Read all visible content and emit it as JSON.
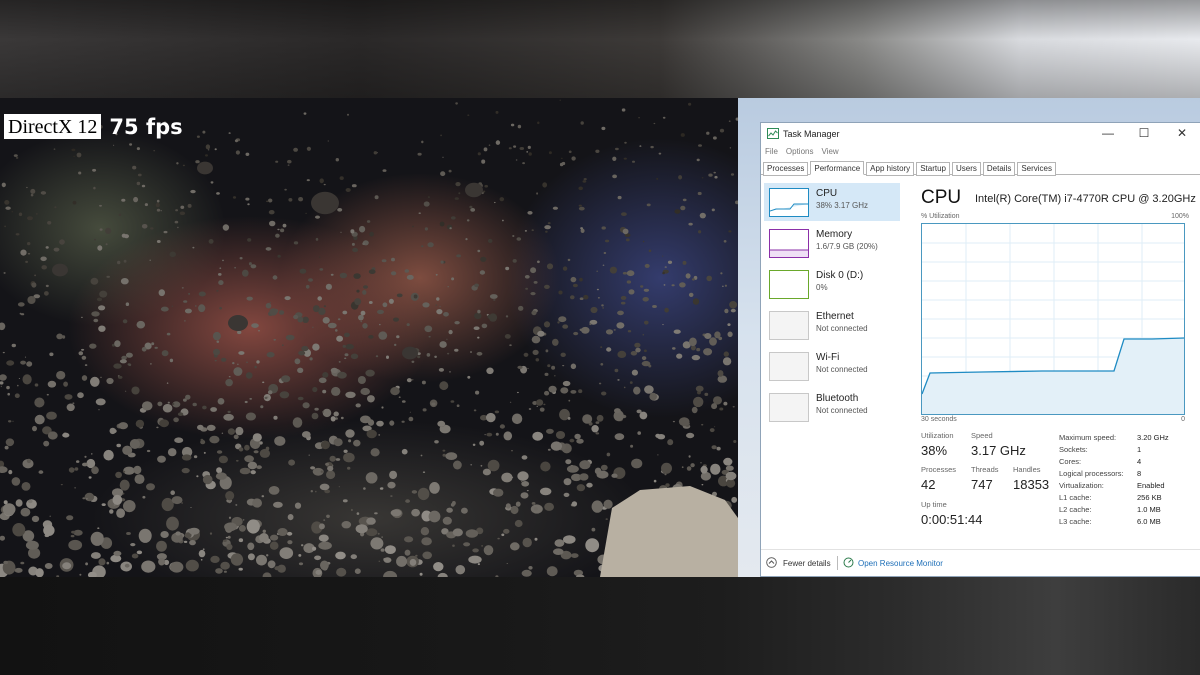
{
  "overlay": {
    "api_label": "DirectX 12",
    "fps_label": "75 fps"
  },
  "task_manager": {
    "title": "Task Manager",
    "window_buttons": {
      "minimize": "—",
      "maximize": "☐",
      "close": "✕"
    },
    "menu": [
      "File",
      "Options",
      "View"
    ],
    "tabs": [
      "Processes",
      "Performance",
      "App history",
      "Startup",
      "Users",
      "Details",
      "Services"
    ],
    "active_tab": "Performance",
    "sidebar": [
      {
        "name": "CPU",
        "detail": "38%  3.17 GHz",
        "color": "#1e8bc3"
      },
      {
        "name": "Memory",
        "detail": "1.6/7.9 GB (20%)",
        "color": "#8b2fa8"
      },
      {
        "name": "Disk 0 (D:)",
        "detail": "0%",
        "color": "#6aa82b"
      },
      {
        "name": "Ethernet",
        "detail": "Not connected",
        "color": "#c8c8c8"
      },
      {
        "name": "Wi-Fi",
        "detail": "Not connected",
        "color": "#c8c8c8"
      },
      {
        "name": "Bluetooth",
        "detail": "Not connected",
        "color": "#c8c8c8"
      }
    ],
    "cpu_panel": {
      "title": "CPU",
      "cpu_name": "Intel(R) Core(TM) i7-4770R CPU @ 3.20GHz",
      "utilization_axis_label": "% Utilization",
      "axis_max": "100%",
      "time_label": "30 seconds",
      "axis_min": "0",
      "graph_color": "#1e8bc3",
      "stats": {
        "utilization_label": "Utilization",
        "utilization": "38%",
        "speed_label": "Speed",
        "speed": "3.17 GHz",
        "processes_label": "Processes",
        "processes": "42",
        "threads_label": "Threads",
        "threads": "747",
        "handles_label": "Handles",
        "handles": "18353",
        "uptime_label": "Up time",
        "uptime": "0:00:51:44"
      },
      "details": [
        {
          "key": "Maximum speed:",
          "value": "3.20 GHz"
        },
        {
          "key": "Sockets:",
          "value": "1"
        },
        {
          "key": "Cores:",
          "value": "4"
        },
        {
          "key": "Logical processors:",
          "value": "8"
        },
        {
          "key": "Virtualization:",
          "value": "Enabled"
        },
        {
          "key": "L1 cache:",
          "value": "256 KB"
        },
        {
          "key": "L2 cache:",
          "value": "1.0 MB"
        },
        {
          "key": "L3 cache:",
          "value": "6.0 MB"
        }
      ]
    },
    "footer": {
      "fewer_details": "Fewer details",
      "open_resource_monitor": "Open Resource Monitor"
    }
  }
}
